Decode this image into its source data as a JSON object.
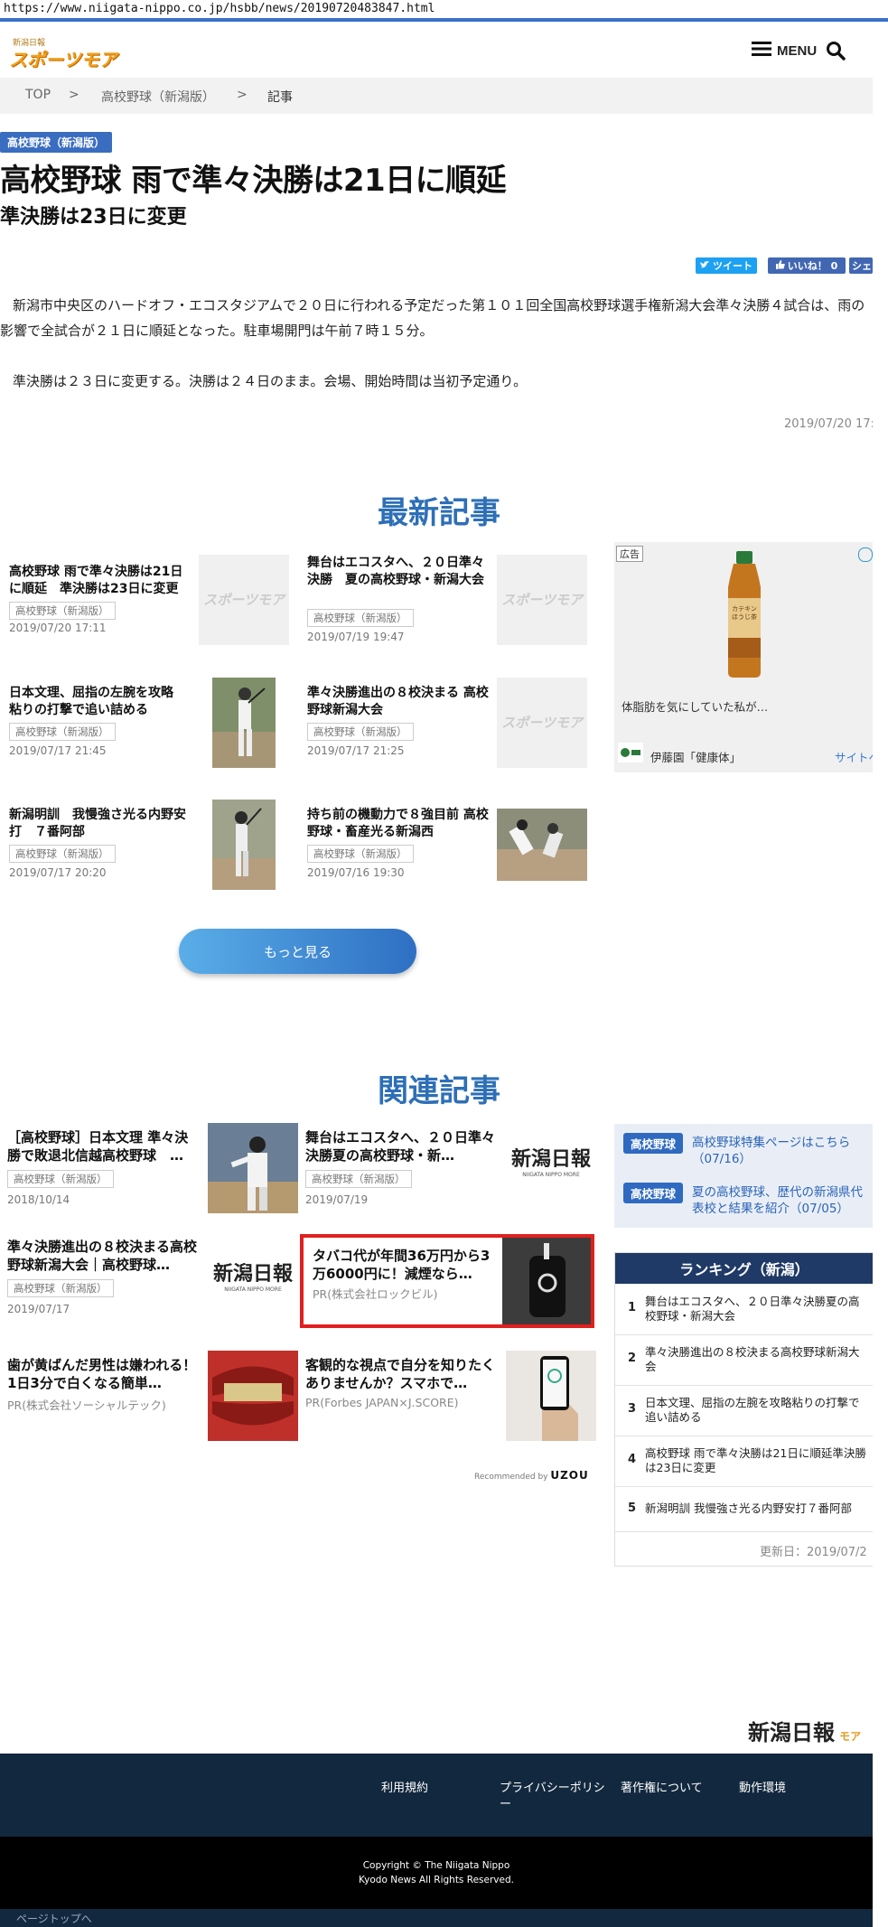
{
  "url": "https://www.niigata-nippo.co.jp/hsbb/news/20190720483847.html",
  "header": {
    "logo_small": "新潟日報",
    "logo_main": "スポーツモア",
    "menu_label": "MENU"
  },
  "breadcrumb": [
    "TOP",
    ">",
    "高校野球（新潟版）",
    ">",
    "記事"
  ],
  "article": {
    "tag": "高校野球（新潟版）",
    "title": "高校野球 雨で準々決勝は21日に順延",
    "subtitle": "準決勝は23日に変更",
    "share_tweet": "ツイート",
    "share_like": "いいね！ 0",
    "share_other": "シェ",
    "paragraph1": "新潟市中央区のハードオフ・エコスタジアムで２０日に行われる予定だった第１０１回全国高校野球選手権新潟大会準々決勝４試合は、雨の影響で全試合が２１日に順延となった。駐車場開門は午前７時１５分。",
    "paragraph2": "準決勝は２３日に変更する。決勝は２４日のまま。会場、開始時間は当初予定通り。",
    "date": "2019/07/20 17:"
  },
  "latest": {
    "heading": "最新記事",
    "items": [
      {
        "title": "高校野球 雨で準々決勝は21日に順延　準決勝は23日に変更",
        "tag": "高校野球（新潟版）",
        "date": "2019/07/20 17:11",
        "thumb": "logo"
      },
      {
        "title": "舞台はエコスタへ、２０日準々決勝　夏の高校野球・新潟大会",
        "tag": "高校野球（新潟版）",
        "date": "2019/07/19 19:47",
        "thumb": "logo"
      },
      {
        "title": "日本文理、屈指の左腕を攻略　粘りの打撃で追い詰める",
        "tag": "高校野球（新潟版）",
        "date": "2019/07/17 21:45",
        "thumb": "photo"
      },
      {
        "title": "準々決勝進出の８校決まる 高校野球新潟大会",
        "tag": "高校野球（新潟版）",
        "date": "2019/07/17 21:25",
        "thumb": "logo"
      },
      {
        "title": "新潟明訓　我慢強さ光る内野安打　７番阿部",
        "tag": "高校野球（新潟版）",
        "date": "2019/07/17 20:20",
        "thumb": "photo"
      },
      {
        "title": "持ち前の機動力で８強目前 高校野球・畜産光る新潟西",
        "tag": "高校野球（新潟版）",
        "date": "2019/07/16 19:30",
        "thumb": "photo"
      }
    ],
    "more_label": "もっと見る"
  },
  "ad": {
    "label": "広告",
    "caption": "体脂肪を気にしていた私が…",
    "brand": "伊藤園「健康体」",
    "site_link": "サイトへ",
    "bottle_text": "カテキンほうじ茶"
  },
  "related": {
    "heading": "関連記事",
    "items": [
      {
        "title": "［高校野球］日本文理 準々決勝で敗退北信越高校野球　…",
        "tag": "高校野球（新潟版）",
        "date": "2018/10/14"
      },
      {
        "title": "舞台はエコスタへ、２０日準々決勝夏の高校野球・新…",
        "tag": "高校野球（新潟版）",
        "date": "2019/07/19"
      },
      {
        "title": "準々決勝進出の８校決まる高校野球新潟大会｜高校野球…",
        "tag": "高校野球（新潟版）",
        "date": "2019/07/17"
      },
      {
        "title": "タバコ代が年間36万円から3万6000円に！減煙なら…",
        "pr": "PR(株式会社ロックビル)"
      },
      {
        "title": "歯が黄ばんだ男性は嫌われる！1日3分で白くなる簡単…",
        "pr": "PR(株式会社ソーシャルテック)"
      },
      {
        "title": "客観的な視点で自分を知りたくありませんか？スマホで…",
        "pr": "PR(Forbes JAPAN×J.SCORE)"
      }
    ],
    "nippo_logo": "新潟日報",
    "nippo_sub": "NIIGATA NIPPO MORE",
    "recommended": "Recommended by",
    "uzou": "UZOU"
  },
  "topics": [
    {
      "tag": "高校野球",
      "link": "高校野球特集ページはこちら（07/16）"
    },
    {
      "tag": "高校野球",
      "link": "夏の高校野球、歴代の新潟県代表校と結果を紹介（07/05）"
    }
  ],
  "ranking": {
    "heading": "ランキング（新潟）",
    "items": [
      {
        "num": "1",
        "text": "舞台はエコスタへ、２０日準々決勝夏の高校野球・新潟大会"
      },
      {
        "num": "2",
        "text": "準々決勝進出の８校決まる高校野球新潟大会"
      },
      {
        "num": "3",
        "text": "日本文理、屈指の左腕を攻略粘りの打撃で追い詰める"
      },
      {
        "num": "4",
        "text": "高校野球 雨で準々決勝は21日に順延準決勝は23日に変更"
      },
      {
        "num": "5",
        "text": "新潟明訓 我慢強さ光る内野安打７番阿部"
      }
    ],
    "updated": "更新日：2019/07/2"
  },
  "footer": {
    "logo": "新潟日報",
    "logo_sub": "モア",
    "links": [
      "利用規約",
      "プライバシーポリシー",
      "著作権について",
      "動作環境"
    ],
    "copyright1": "Copyright © The Niigata Nippo",
    "copyright2": "Kyodo News All Rights Reserved.",
    "pagetop": "ページトップへ"
  }
}
